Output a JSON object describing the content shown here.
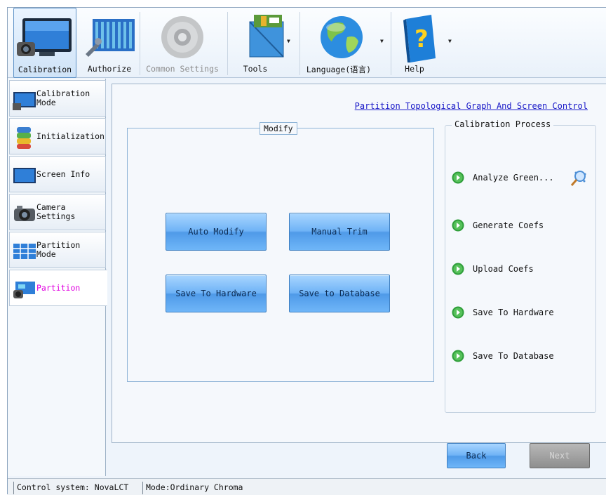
{
  "toolbar": {
    "items": [
      {
        "label": "Calibration",
        "icon": "calibration-monitor-icon",
        "state": "active"
      },
      {
        "label": "Authorize",
        "icon": "authorize-screen-icon",
        "state": "normal"
      },
      {
        "label": "Common Settings",
        "icon": "settings-gear-icon",
        "state": "disabled"
      },
      {
        "label": "Tools",
        "icon": "tools-icon",
        "state": "normal",
        "dropdown": true
      },
      {
        "label": "Language(语言)",
        "icon": "globe-icon",
        "state": "normal",
        "dropdown": true
      },
      {
        "label": "Help",
        "icon": "help-book-icon",
        "state": "normal",
        "dropdown": true
      }
    ],
    "dropdown_glyph": "▼"
  },
  "sidebar": {
    "items": [
      {
        "label": "Calibration Mode",
        "icon": "calibration-mode-icon",
        "active": false
      },
      {
        "label": "Initialization",
        "icon": "initialization-icon",
        "active": false
      },
      {
        "label": "Screen Info",
        "icon": "screen-info-icon",
        "active": false
      },
      {
        "label": "Camera Settings",
        "icon": "camera-icon",
        "active": false
      },
      {
        "label": "Partition Mode",
        "icon": "partition-grid-icon",
        "active": false
      },
      {
        "label": "Partition",
        "icon": "partition-icon",
        "active": true
      }
    ]
  },
  "main": {
    "top_link": "Partition Topological Graph And Screen Control",
    "modify": {
      "legend": "Modify",
      "buttons": {
        "auto_modify": "Auto Modify",
        "manual_trim": "Manual Trim",
        "save_to_hardware": "Save To Hardware",
        "save_to_database": "Save to Database"
      }
    },
    "process": {
      "title": "Calibration Process",
      "steps": [
        "Analyze Green...",
        "Generate Coefs",
        "Upload Coefs",
        "Save To Hardware",
        "Save To Database"
      ],
      "step_icon": "green-arrow-circle-icon",
      "analyze_icon": "magnifier-icon"
    },
    "back_label": "Back",
    "next_label": "Next"
  },
  "status": {
    "control_system": "Control system: NovaLCT",
    "mode": "Mode:Ordinary Chroma"
  },
  "colors": {
    "accent_blue": "#6fb3f6",
    "active_nav_text": "#e000e0",
    "link": "#1818c8",
    "step_green": "#2f9e3a"
  }
}
